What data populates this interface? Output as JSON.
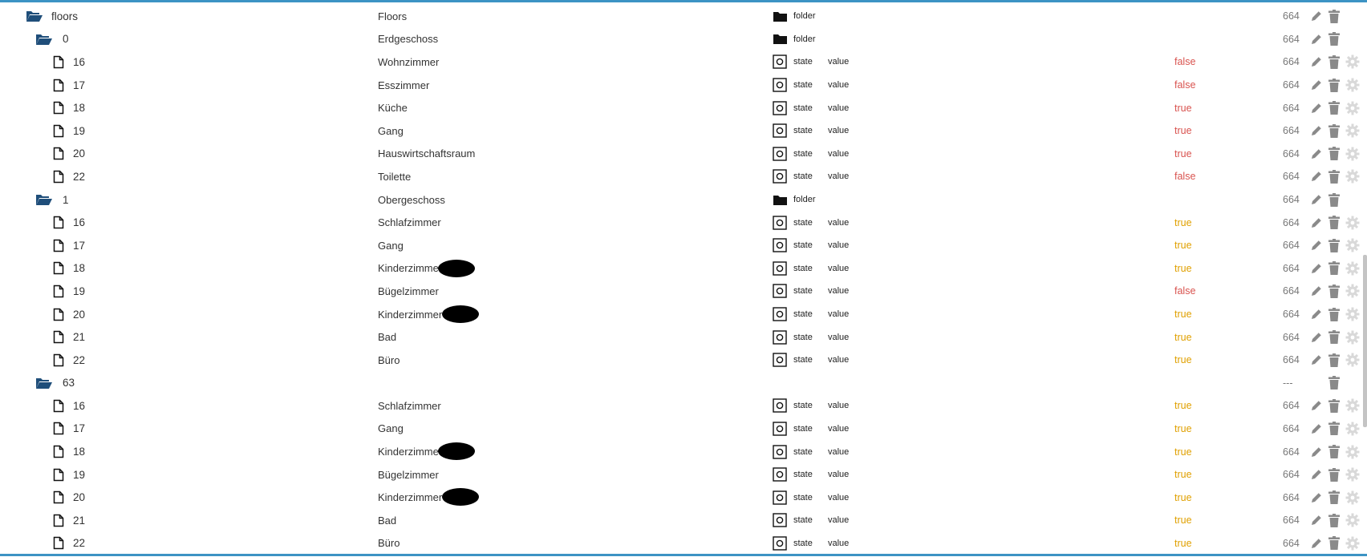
{
  "colors": {
    "accent": "#3c93c4",
    "folder": "#1f4e7a",
    "true_value": "#e0a000",
    "false_value": "#d9534f",
    "action_icon": "#8a8a8a",
    "cog_icon": "#d9d9d9"
  },
  "rows": [
    {
      "kind": "folder",
      "level": 0,
      "id": "floors",
      "name": "Floors",
      "type": "folder",
      "role": "",
      "value": "",
      "value_class": "",
      "acl": "664",
      "cog": false,
      "edit": true
    },
    {
      "kind": "folder",
      "level": 1,
      "id": "0",
      "name": "Erdgeschoss",
      "type": "folder",
      "role": "",
      "value": "",
      "value_class": "",
      "acl": "664",
      "cog": false,
      "edit": true
    },
    {
      "kind": "state",
      "level": 2,
      "id": "16",
      "name": "Wohnzimmer",
      "type": "state",
      "role": "value",
      "value": "false",
      "value_class": "v-false",
      "acl": "664",
      "cog": true,
      "edit": true
    },
    {
      "kind": "state",
      "level": 2,
      "id": "17",
      "name": "Esszimmer",
      "type": "state",
      "role": "value",
      "value": "false",
      "value_class": "v-false",
      "acl": "664",
      "cog": true,
      "edit": true
    },
    {
      "kind": "state",
      "level": 2,
      "id": "18",
      "name": "Küche",
      "type": "state",
      "role": "value",
      "value": "true",
      "value_class": "v-true-red",
      "acl": "664",
      "cog": true,
      "edit": true
    },
    {
      "kind": "state",
      "level": 2,
      "id": "19",
      "name": "Gang",
      "type": "state",
      "role": "value",
      "value": "true",
      "value_class": "v-true-red",
      "acl": "664",
      "cog": true,
      "edit": true
    },
    {
      "kind": "state",
      "level": 2,
      "id": "20",
      "name": "Hauswirtschaftsraum",
      "type": "state",
      "role": "value",
      "value": "true",
      "value_class": "v-true-red",
      "acl": "664",
      "cog": true,
      "edit": true
    },
    {
      "kind": "state",
      "level": 2,
      "id": "22",
      "name": "Toilette",
      "type": "state",
      "role": "value",
      "value": "false",
      "value_class": "v-false",
      "acl": "664",
      "cog": true,
      "edit": true
    },
    {
      "kind": "folder",
      "level": 1,
      "id": "1",
      "name": "Obergeschoss",
      "type": "folder",
      "role": "",
      "value": "",
      "value_class": "",
      "acl": "664",
      "cog": false,
      "edit": true
    },
    {
      "kind": "state",
      "level": 2,
      "id": "16",
      "name": "Schlafzimmer",
      "type": "state",
      "role": "value",
      "value": "true",
      "value_class": "v-true",
      "acl": "664",
      "cog": true,
      "edit": true
    },
    {
      "kind": "state",
      "level": 2,
      "id": "17",
      "name": "Gang",
      "type": "state",
      "role": "value",
      "value": "true",
      "value_class": "v-true",
      "acl": "664",
      "cog": true,
      "edit": true
    },
    {
      "kind": "state",
      "level": 2,
      "id": "18",
      "name": "Kinderzimme",
      "redacted": true,
      "type": "state",
      "role": "value",
      "value": "true",
      "value_class": "v-true",
      "acl": "664",
      "cog": true,
      "edit": true
    },
    {
      "kind": "state",
      "level": 2,
      "id": "19",
      "name": "Bügelzimmer",
      "type": "state",
      "role": "value",
      "value": "false",
      "value_class": "v-false",
      "acl": "664",
      "cog": true,
      "edit": true
    },
    {
      "kind": "state",
      "level": 2,
      "id": "20",
      "name": "Kinderzimmer",
      "redacted": true,
      "type": "state",
      "role": "value",
      "value": "true",
      "value_class": "v-true",
      "acl": "664",
      "cog": true,
      "edit": true
    },
    {
      "kind": "state",
      "level": 2,
      "id": "21",
      "name": "Bad",
      "type": "state",
      "role": "value",
      "value": "true",
      "value_class": "v-true",
      "acl": "664",
      "cog": true,
      "edit": true
    },
    {
      "kind": "state",
      "level": 2,
      "id": "22",
      "name": "Büro",
      "type": "state",
      "role": "value",
      "value": "true",
      "value_class": "v-true",
      "acl": "664",
      "cog": true,
      "edit": true
    },
    {
      "kind": "folder",
      "level": 1,
      "id": "63",
      "name": "",
      "type": "",
      "role": "",
      "value": "",
      "value_class": "",
      "acl": "---",
      "cog": false,
      "edit": false
    },
    {
      "kind": "state",
      "level": 2,
      "id": "16",
      "name": "Schlafzimmer",
      "type": "state",
      "role": "value",
      "value": "true",
      "value_class": "v-true",
      "acl": "664",
      "cog": true,
      "edit": true
    },
    {
      "kind": "state",
      "level": 2,
      "id": "17",
      "name": "Gang",
      "type": "state",
      "role": "value",
      "value": "true",
      "value_class": "v-true",
      "acl": "664",
      "cog": true,
      "edit": true
    },
    {
      "kind": "state",
      "level": 2,
      "id": "18",
      "name": "Kinderzimme",
      "redacted": true,
      "type": "state",
      "role": "value",
      "value": "true",
      "value_class": "v-true",
      "acl": "664",
      "cog": true,
      "edit": true
    },
    {
      "kind": "state",
      "level": 2,
      "id": "19",
      "name": "Bügelzimmer",
      "type": "state",
      "role": "value",
      "value": "true",
      "value_class": "v-true",
      "acl": "664",
      "cog": true,
      "edit": true
    },
    {
      "kind": "state",
      "level": 2,
      "id": "20",
      "name": "Kinderzimmer",
      "redacted": true,
      "type": "state",
      "role": "value",
      "value": "true",
      "value_class": "v-true",
      "acl": "664",
      "cog": true,
      "edit": true
    },
    {
      "kind": "state",
      "level": 2,
      "id": "21",
      "name": "Bad",
      "type": "state",
      "role": "value",
      "value": "true",
      "value_class": "v-true",
      "acl": "664",
      "cog": true,
      "edit": true
    },
    {
      "kind": "state",
      "level": 2,
      "id": "22",
      "name": "Büro",
      "type": "state",
      "role": "value",
      "value": "true",
      "value_class": "v-true",
      "acl": "664",
      "cog": true,
      "edit": true
    }
  ]
}
